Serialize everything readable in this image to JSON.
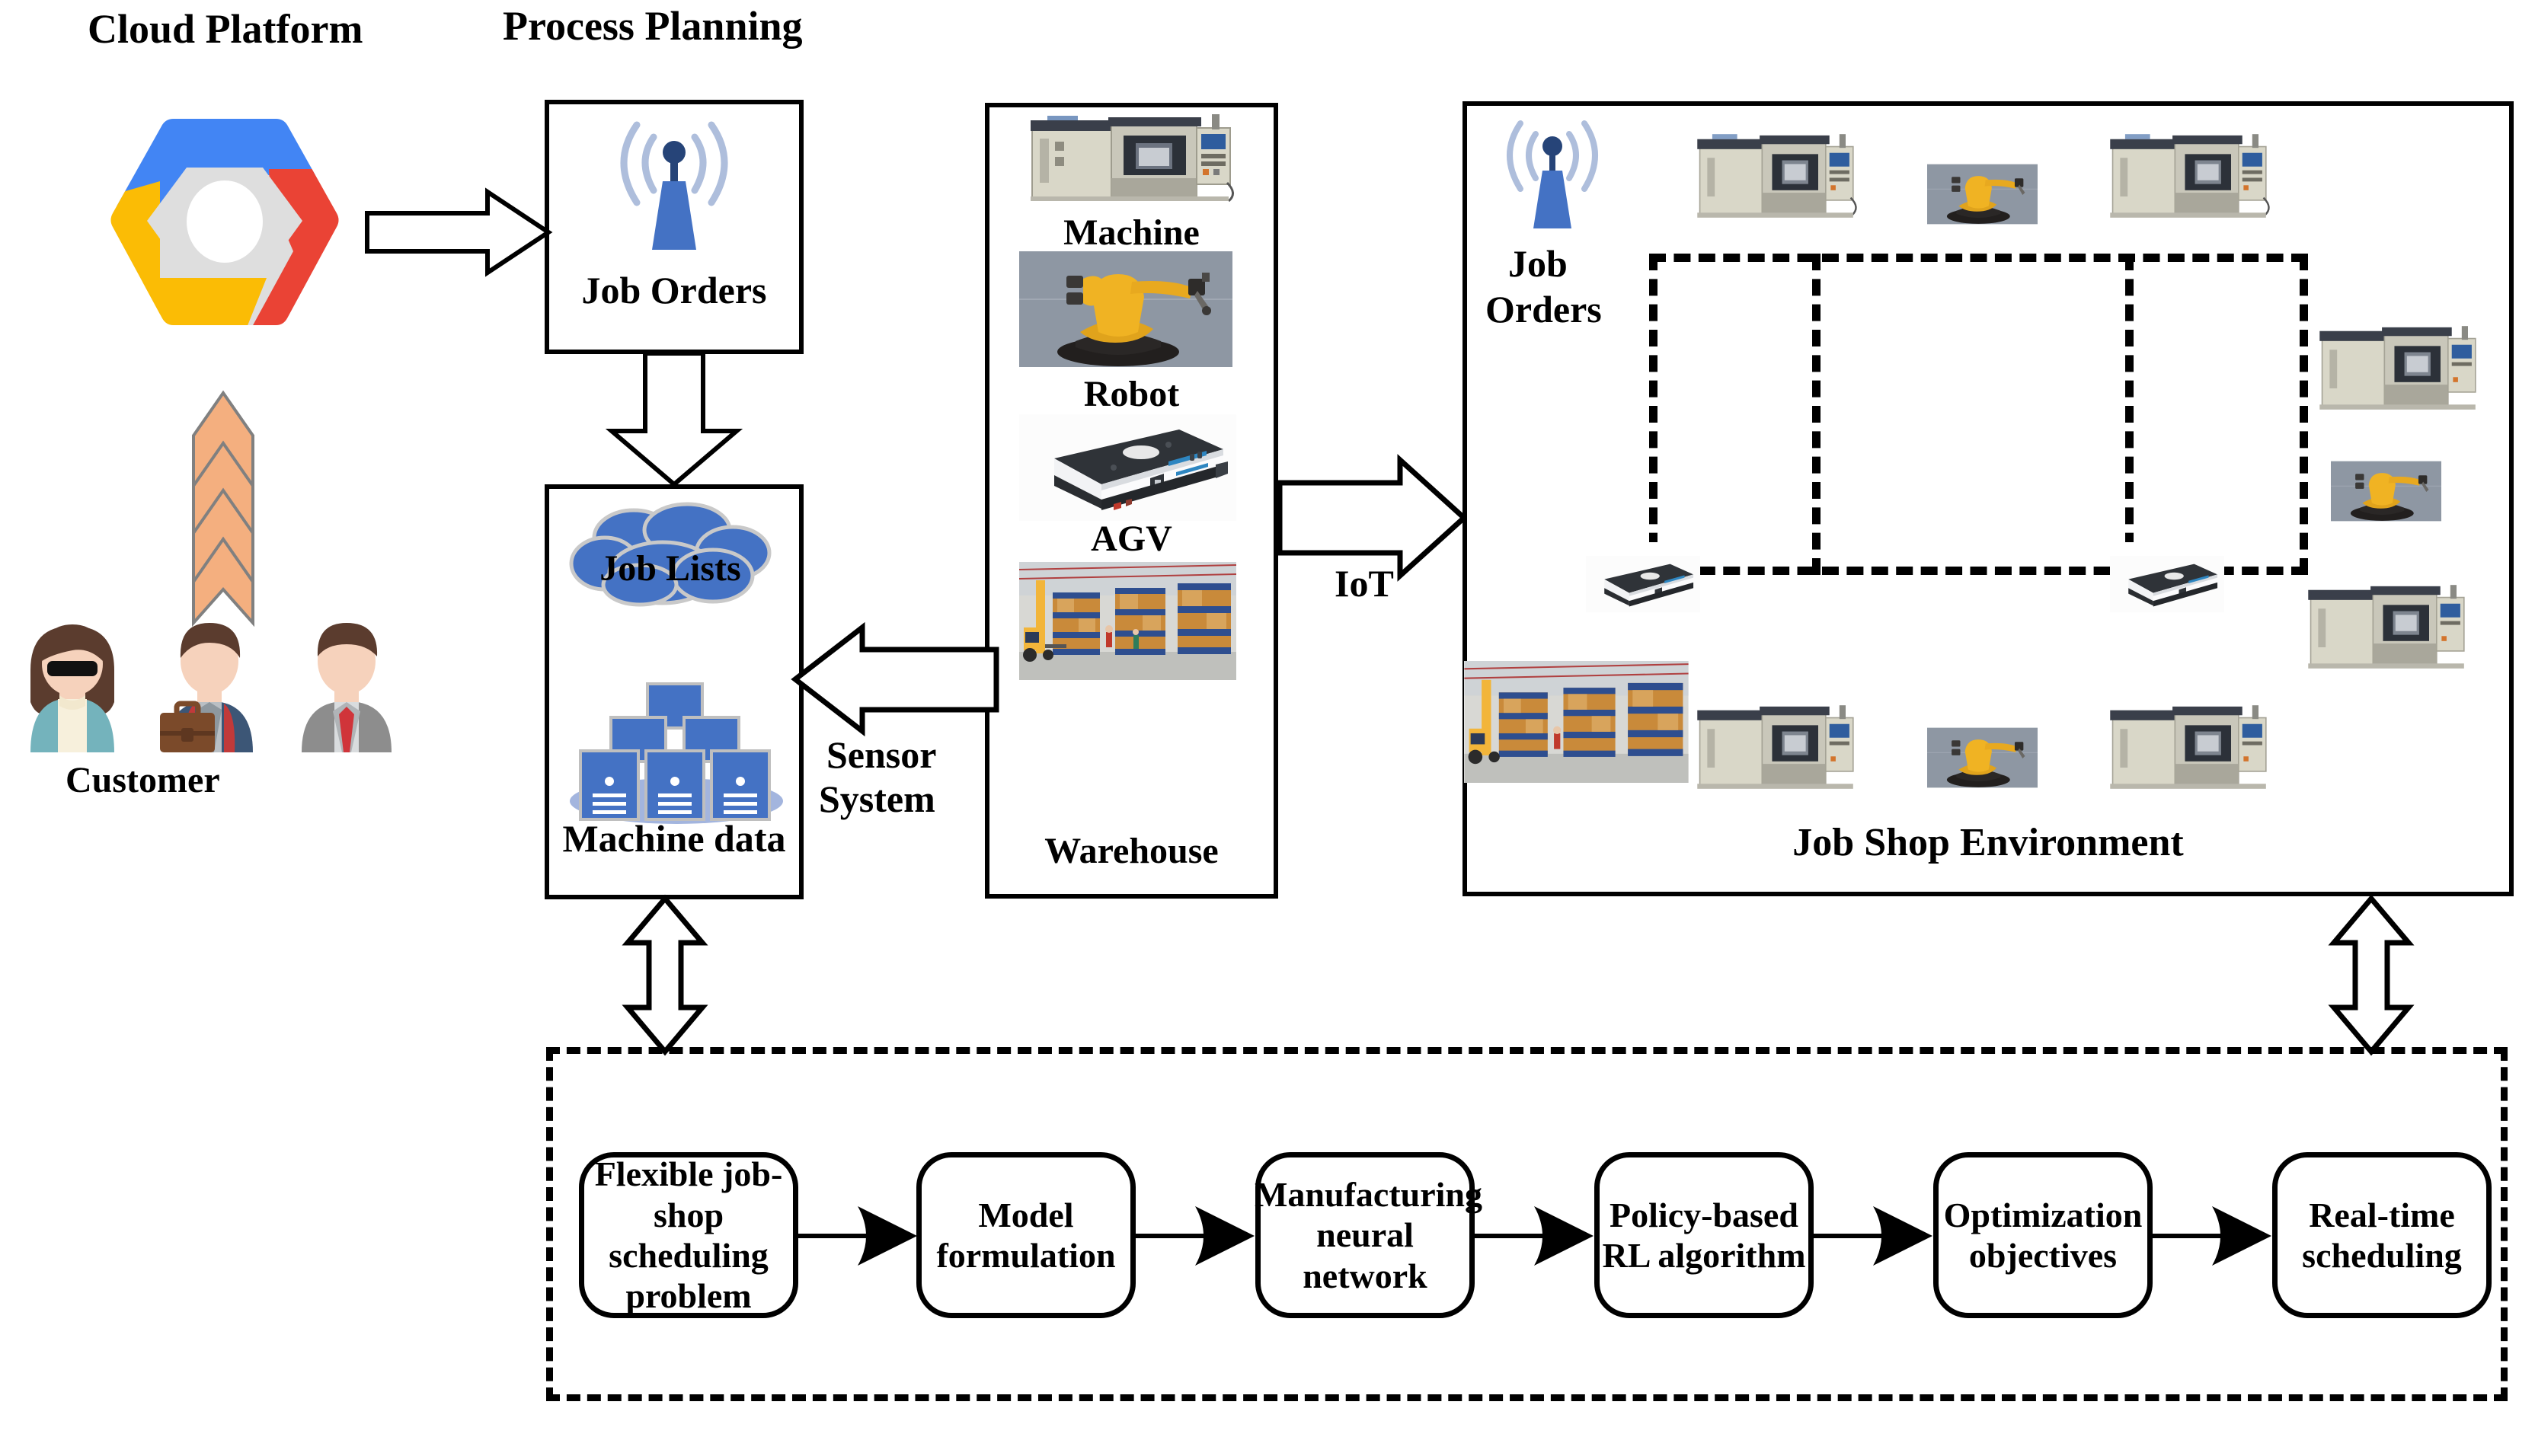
{
  "diagram": {
    "title_cloud": "Cloud Platform",
    "title_process": "Process Planning",
    "customer_label": "Customer",
    "iot_label": "IoT",
    "sensor_label_line1": "Sensor",
    "sensor_label_line2": "System",
    "jobshop_label": "Job Shop Environment"
  },
  "process_planning": {
    "job_orders_label": "Job Orders",
    "job_lists_label": "Job Lists",
    "machine_data_label": "Machine data"
  },
  "sensor_system": {
    "items": [
      {
        "caption": "Machine",
        "icon": "cnc-machine-photo"
      },
      {
        "caption": "Robot",
        "icon": "robot-arm-photo"
      },
      {
        "caption": "AGV",
        "icon": "agv-photo"
      },
      {
        "caption": "Warehouse",
        "icon": "warehouse-photo"
      }
    ]
  },
  "job_shop": {
    "job_orders_line1": "Job",
    "job_orders_line2": "Orders",
    "caption": "Job Shop Environment"
  },
  "workflow": {
    "steps": [
      {
        "label": "Flexible job-shop scheduling problem"
      },
      {
        "label": "Model formulation"
      },
      {
        "label": "Manufacturing neural network"
      },
      {
        "label": "Policy-based RL algorithm"
      },
      {
        "label": "Optimization objectives"
      },
      {
        "label": "Real-time scheduling"
      }
    ]
  },
  "colors": {
    "gcp_blue": "#4285F4",
    "gcp_red": "#EA4335",
    "gcp_yellow": "#FBBC05",
    "gcp_grey": "#DEDEDE",
    "tower_blue": "#4472C4",
    "tower_dot": "#264478",
    "wave_grey": "#AEBEDC",
    "chevron_orange": "#F4AF7F",
    "chevron_stroke": "#808080",
    "server_blue": "#4472C4",
    "cloud_blue": "#4472C4",
    "customer1_coat": "#74B3BC",
    "customer2_suit": "#3C5676",
    "customer3_suit": "#8D8D8D",
    "tie_red": "#D0343A",
    "skin": "#F6D2BC",
    "hair": "#5B3C2E",
    "outline": "#000000"
  }
}
